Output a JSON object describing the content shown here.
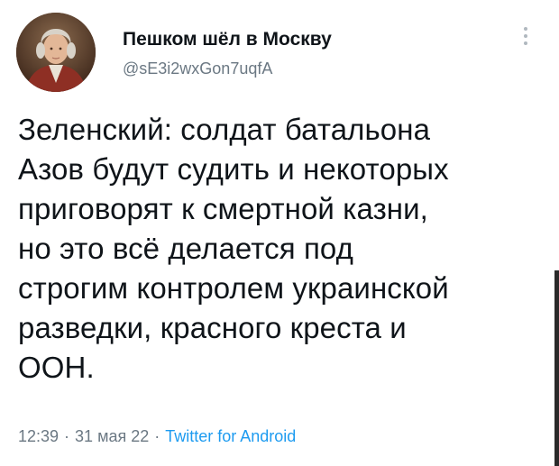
{
  "user": {
    "display_name": "Пешком шёл в Москву",
    "handle": "@sE3i2wxGon7uqfA"
  },
  "tweet": {
    "text": "Зеленский: солдат батальона\nАзов будут судить и некоторых\nприговорят к смертной казни,\nно это всё делается под\nстрогим контролем украинской\nразведки, красного креста и\nООН."
  },
  "meta": {
    "time": "12:39",
    "date": "31 мая 22",
    "separator": "·",
    "source": "Twitter for Android"
  },
  "colors": {
    "text": "#0f1419",
    "secondary": "#6b7883",
    "link": "#1d9bf0"
  },
  "icons": {
    "more": "more-vertical-icon",
    "avatar": "portrait-avatar"
  }
}
